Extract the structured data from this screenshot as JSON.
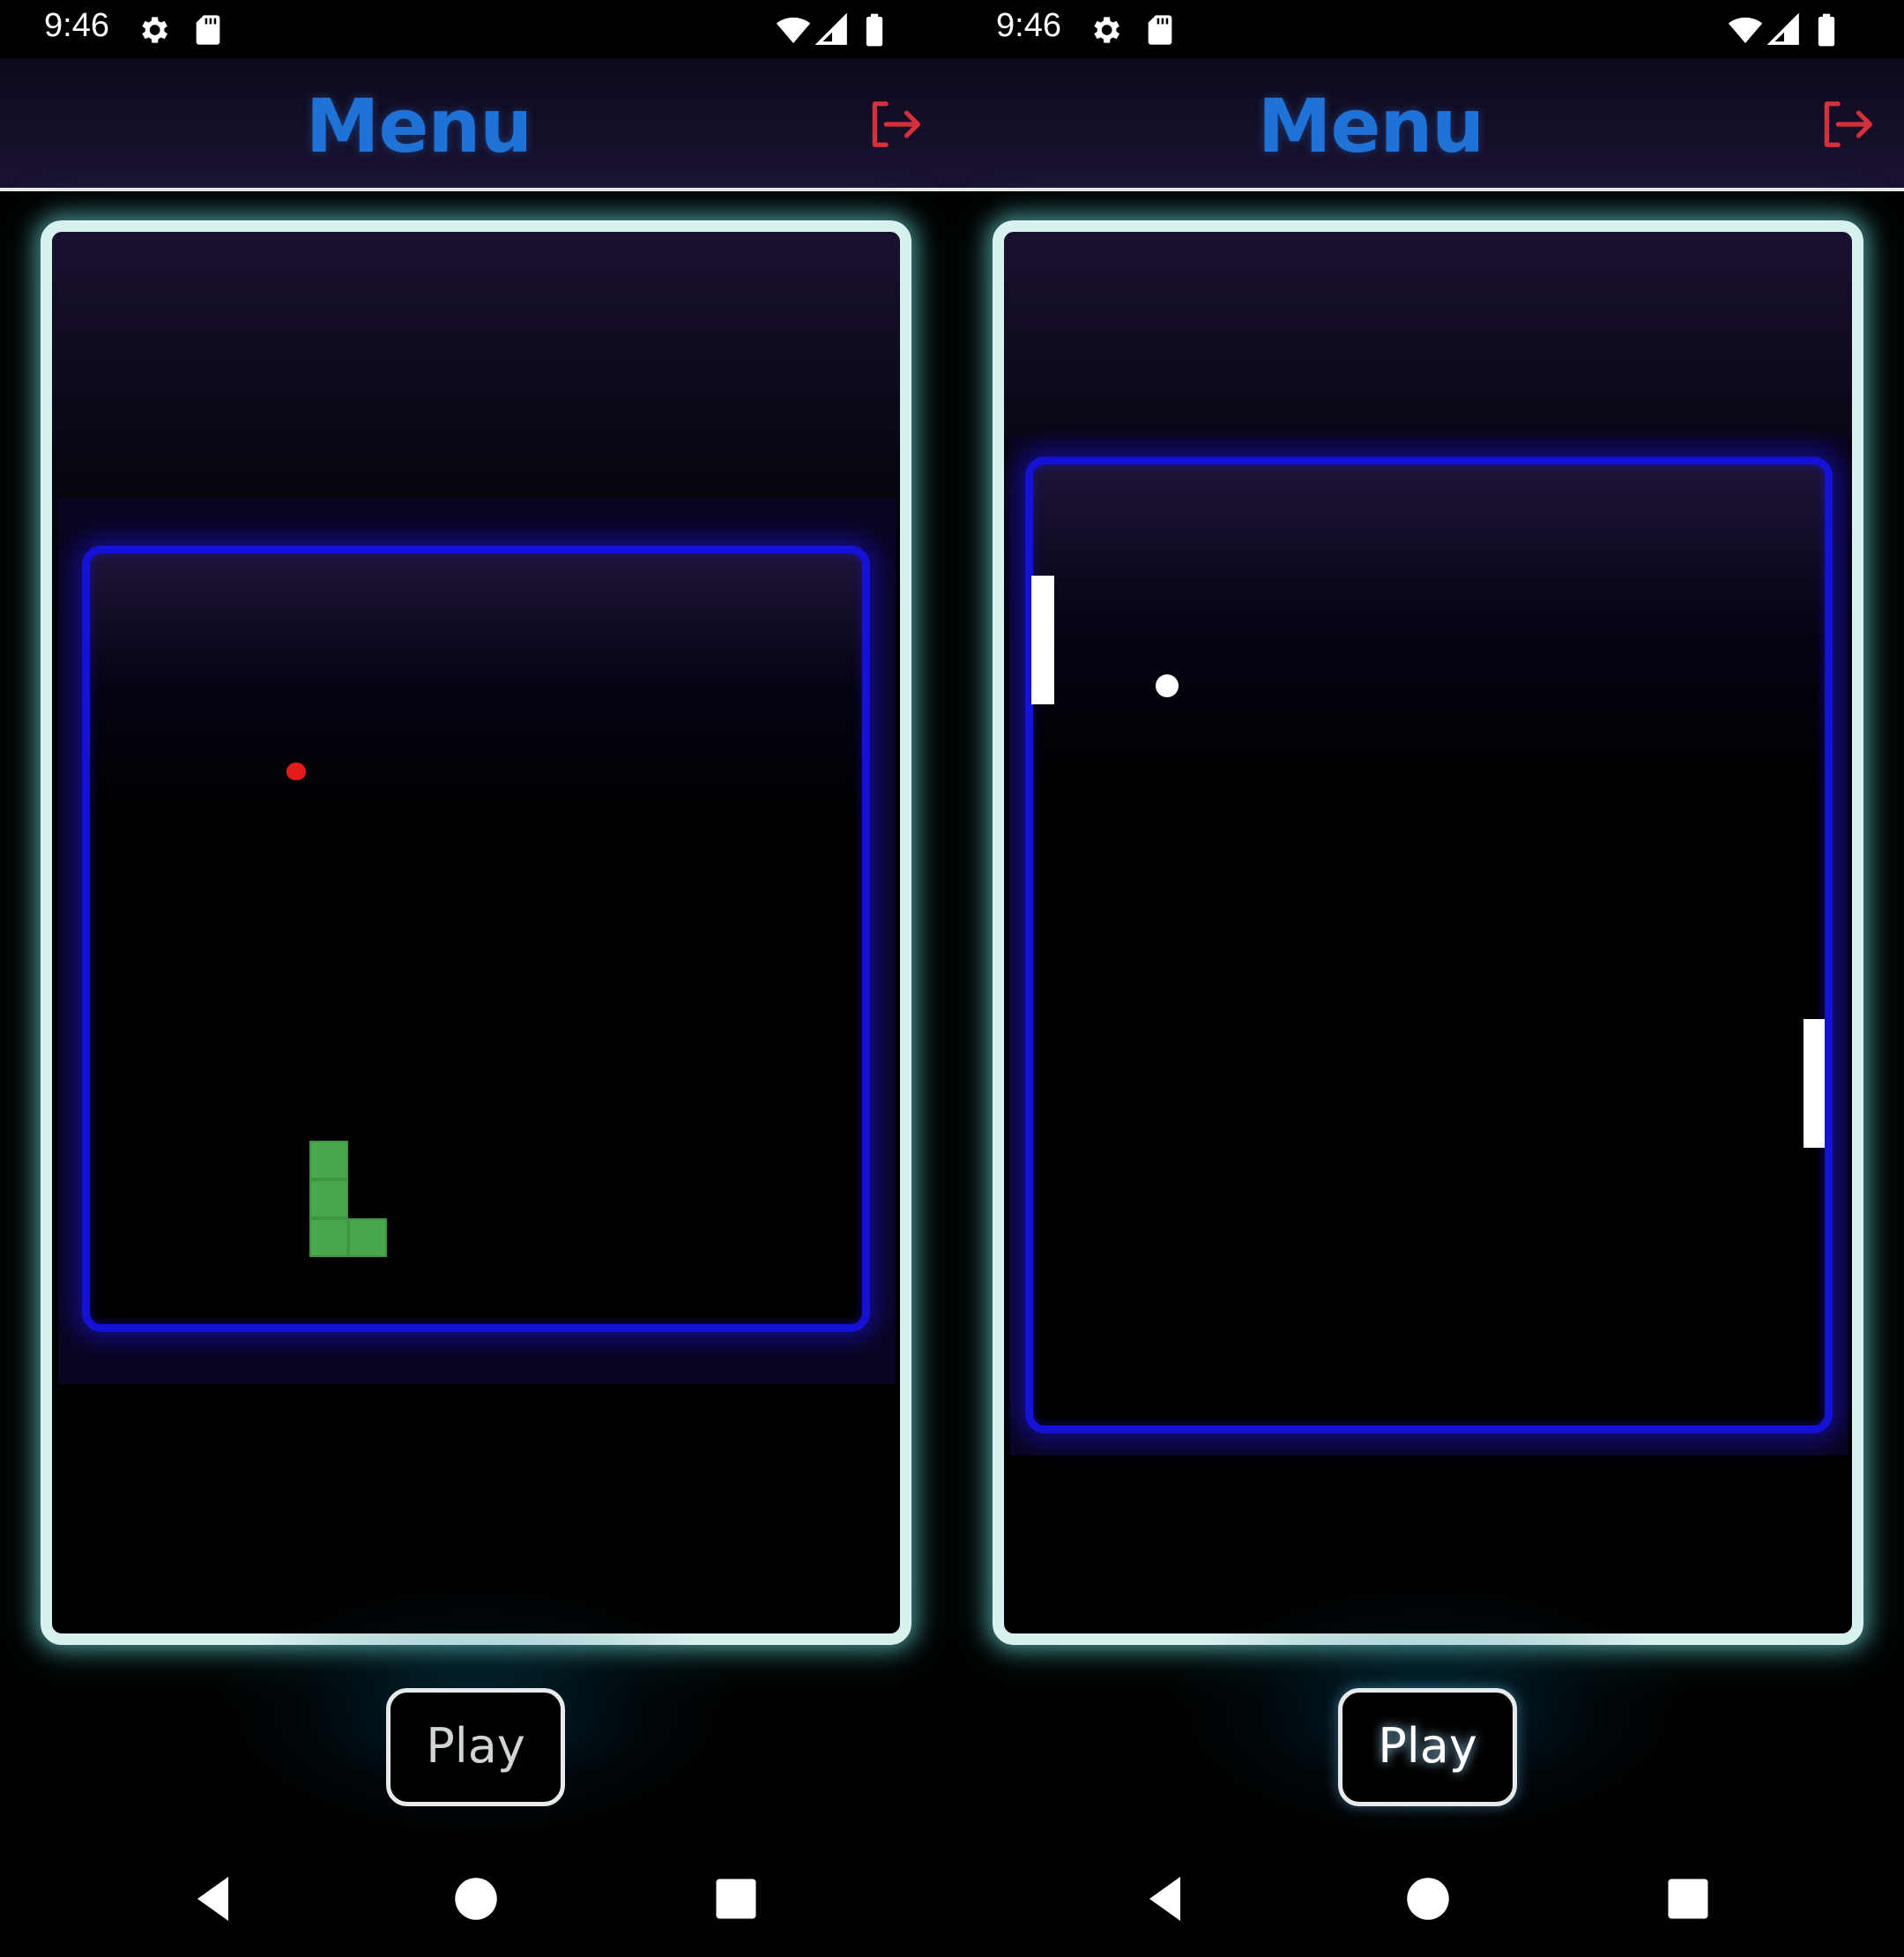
{
  "screens": [
    {
      "status": {
        "time": "9:46"
      },
      "header": {
        "title": "Menu"
      },
      "game": {
        "preview": "snake"
      },
      "play_label": "Play"
    },
    {
      "status": {
        "time": "9:46"
      },
      "header": {
        "title": "Menu"
      },
      "game": {
        "preview": "pong"
      },
      "play_label": "Play"
    }
  ],
  "icons": {
    "status_left": [
      "gear-icon",
      "sd-card-icon"
    ],
    "status_right": [
      "wifi-icon",
      "signal-icon",
      "battery-icon"
    ],
    "header_action": "logout-icon",
    "nav": [
      "back-icon",
      "home-icon",
      "recents-icon"
    ]
  },
  "colors": {
    "title_blue": "#1f72d6",
    "logout_red": "#d6303c",
    "card_glow": "#d6f1ee",
    "arena_blue": "#1512d6",
    "snake_green": "#4aa84c",
    "food_red": "#e41b1b"
  }
}
